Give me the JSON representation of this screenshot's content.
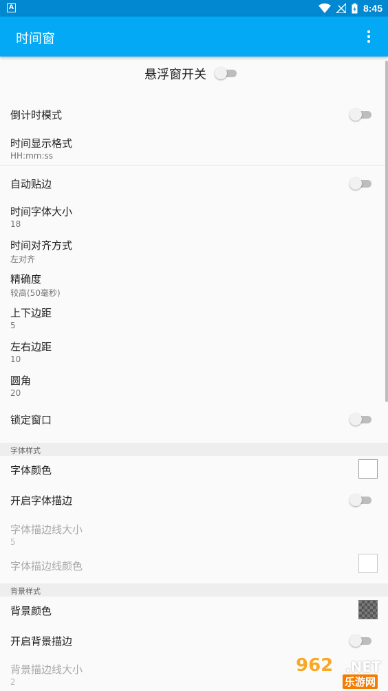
{
  "status_bar": {
    "app_glyph": "A",
    "time": "8:45",
    "icons": [
      "wifi-icon",
      "no-signal-icon",
      "battery-icon"
    ]
  },
  "app_bar": {
    "title": "时间窗",
    "menu_icon": "more-vert-icon"
  },
  "master_switch": {
    "label": "悬浮窗开关",
    "on": false
  },
  "settings": {
    "countdown": {
      "label": "倒计时模式",
      "on": false
    },
    "time_format": {
      "label": "时间显示格式",
      "summary": "HH:mm:ss"
    },
    "auto_snap": {
      "label": "自动贴边",
      "on": false
    },
    "font_size": {
      "label": "时间字体大小",
      "summary": "18"
    },
    "align": {
      "label": "时间对齐方式",
      "summary": "左对齐"
    },
    "precision": {
      "label": "精确度",
      "summary": "较高(50毫秒)"
    },
    "vpadding": {
      "label": "上下边距",
      "summary": "5"
    },
    "hpadding": {
      "label": "左右边距",
      "summary": "10"
    },
    "radius": {
      "label": "圆角",
      "summary": "20"
    },
    "lock": {
      "label": "锁定窗口",
      "on": false
    }
  },
  "font_style": {
    "header": "字体样式",
    "color": {
      "label": "字体颜色",
      "swatch": "#ffffff"
    },
    "stroke_enable": {
      "label": "开启字体描边",
      "on": false
    },
    "stroke_size": {
      "label": "字体描边线大小",
      "summary": "5"
    },
    "stroke_color": {
      "label": "字体描边线颜色",
      "swatch": "#ffffff"
    }
  },
  "bg_style": {
    "header": "背景样式",
    "color": {
      "label": "背景颜色",
      "swatch": "transparent-checker"
    },
    "stroke_enable": {
      "label": "开启背景描边",
      "on": false
    },
    "stroke_size": {
      "label": "背景描边线大小",
      "summary": "2"
    }
  },
  "watermark": {
    "number": "962",
    "suffix": ".NET",
    "cn": "乐游网"
  },
  "colors": {
    "status_bar": "#0288d1",
    "app_bar": "#03a9f4",
    "background": "#fafafa"
  }
}
